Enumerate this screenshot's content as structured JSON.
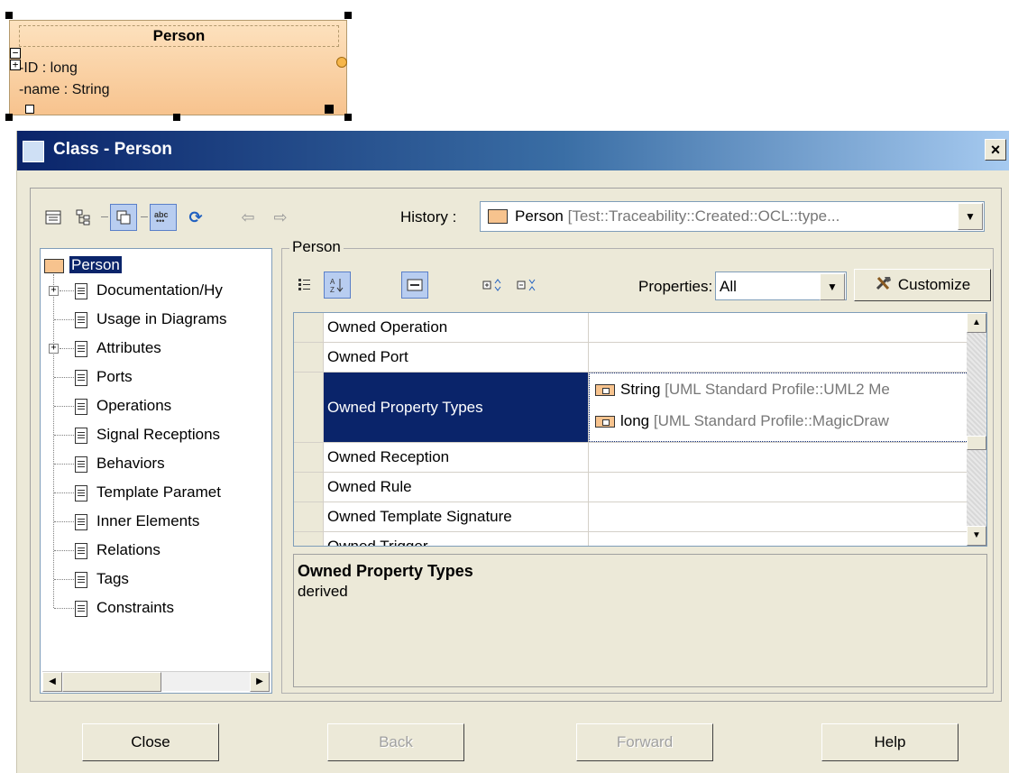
{
  "uml": {
    "class_name": "Person",
    "attributes": [
      "-ID : long",
      "-name : String"
    ]
  },
  "dialog": {
    "title": "Class - Person",
    "close_glyph": "×"
  },
  "toolbar": {
    "history_label": "History :",
    "history_value": "Person",
    "history_path": " [Test::Traceability::Created::OCL::type..."
  },
  "tree": {
    "root": "Person",
    "items": [
      "Documentation/Hy",
      "Usage in Diagrams",
      "Attributes",
      "Ports",
      "Operations",
      "Signal Receptions",
      "Behaviors",
      "Template Paramet",
      "Inner Elements",
      "Relations",
      "Tags",
      "Constraints"
    ]
  },
  "panel": {
    "group_title": "Person",
    "properties_label": "Properties:",
    "properties_value": "All",
    "customize_label": "Customize"
  },
  "table": {
    "rows": [
      {
        "name": "Owned Operation",
        "values": []
      },
      {
        "name": "Owned Port",
        "values": []
      },
      {
        "name": "Owned Property Types",
        "values": [
          {
            "name": "String",
            "path": " [UML Standard Profile::UML2 Me"
          },
          {
            "name": "long",
            "path": " [UML Standard Profile::MagicDraw"
          }
        ],
        "selected": true
      },
      {
        "name": "Owned Reception",
        "values": []
      },
      {
        "name": "Owned Rule",
        "values": []
      },
      {
        "name": "Owned Template Signature",
        "values": []
      },
      {
        "name": "Owned Trigger",
        "values": []
      }
    ]
  },
  "description": {
    "title": "Owned Property Types",
    "text": "derived"
  },
  "buttons": {
    "close": "Close",
    "back": "Back",
    "forward": "Forward",
    "help": "Help"
  }
}
